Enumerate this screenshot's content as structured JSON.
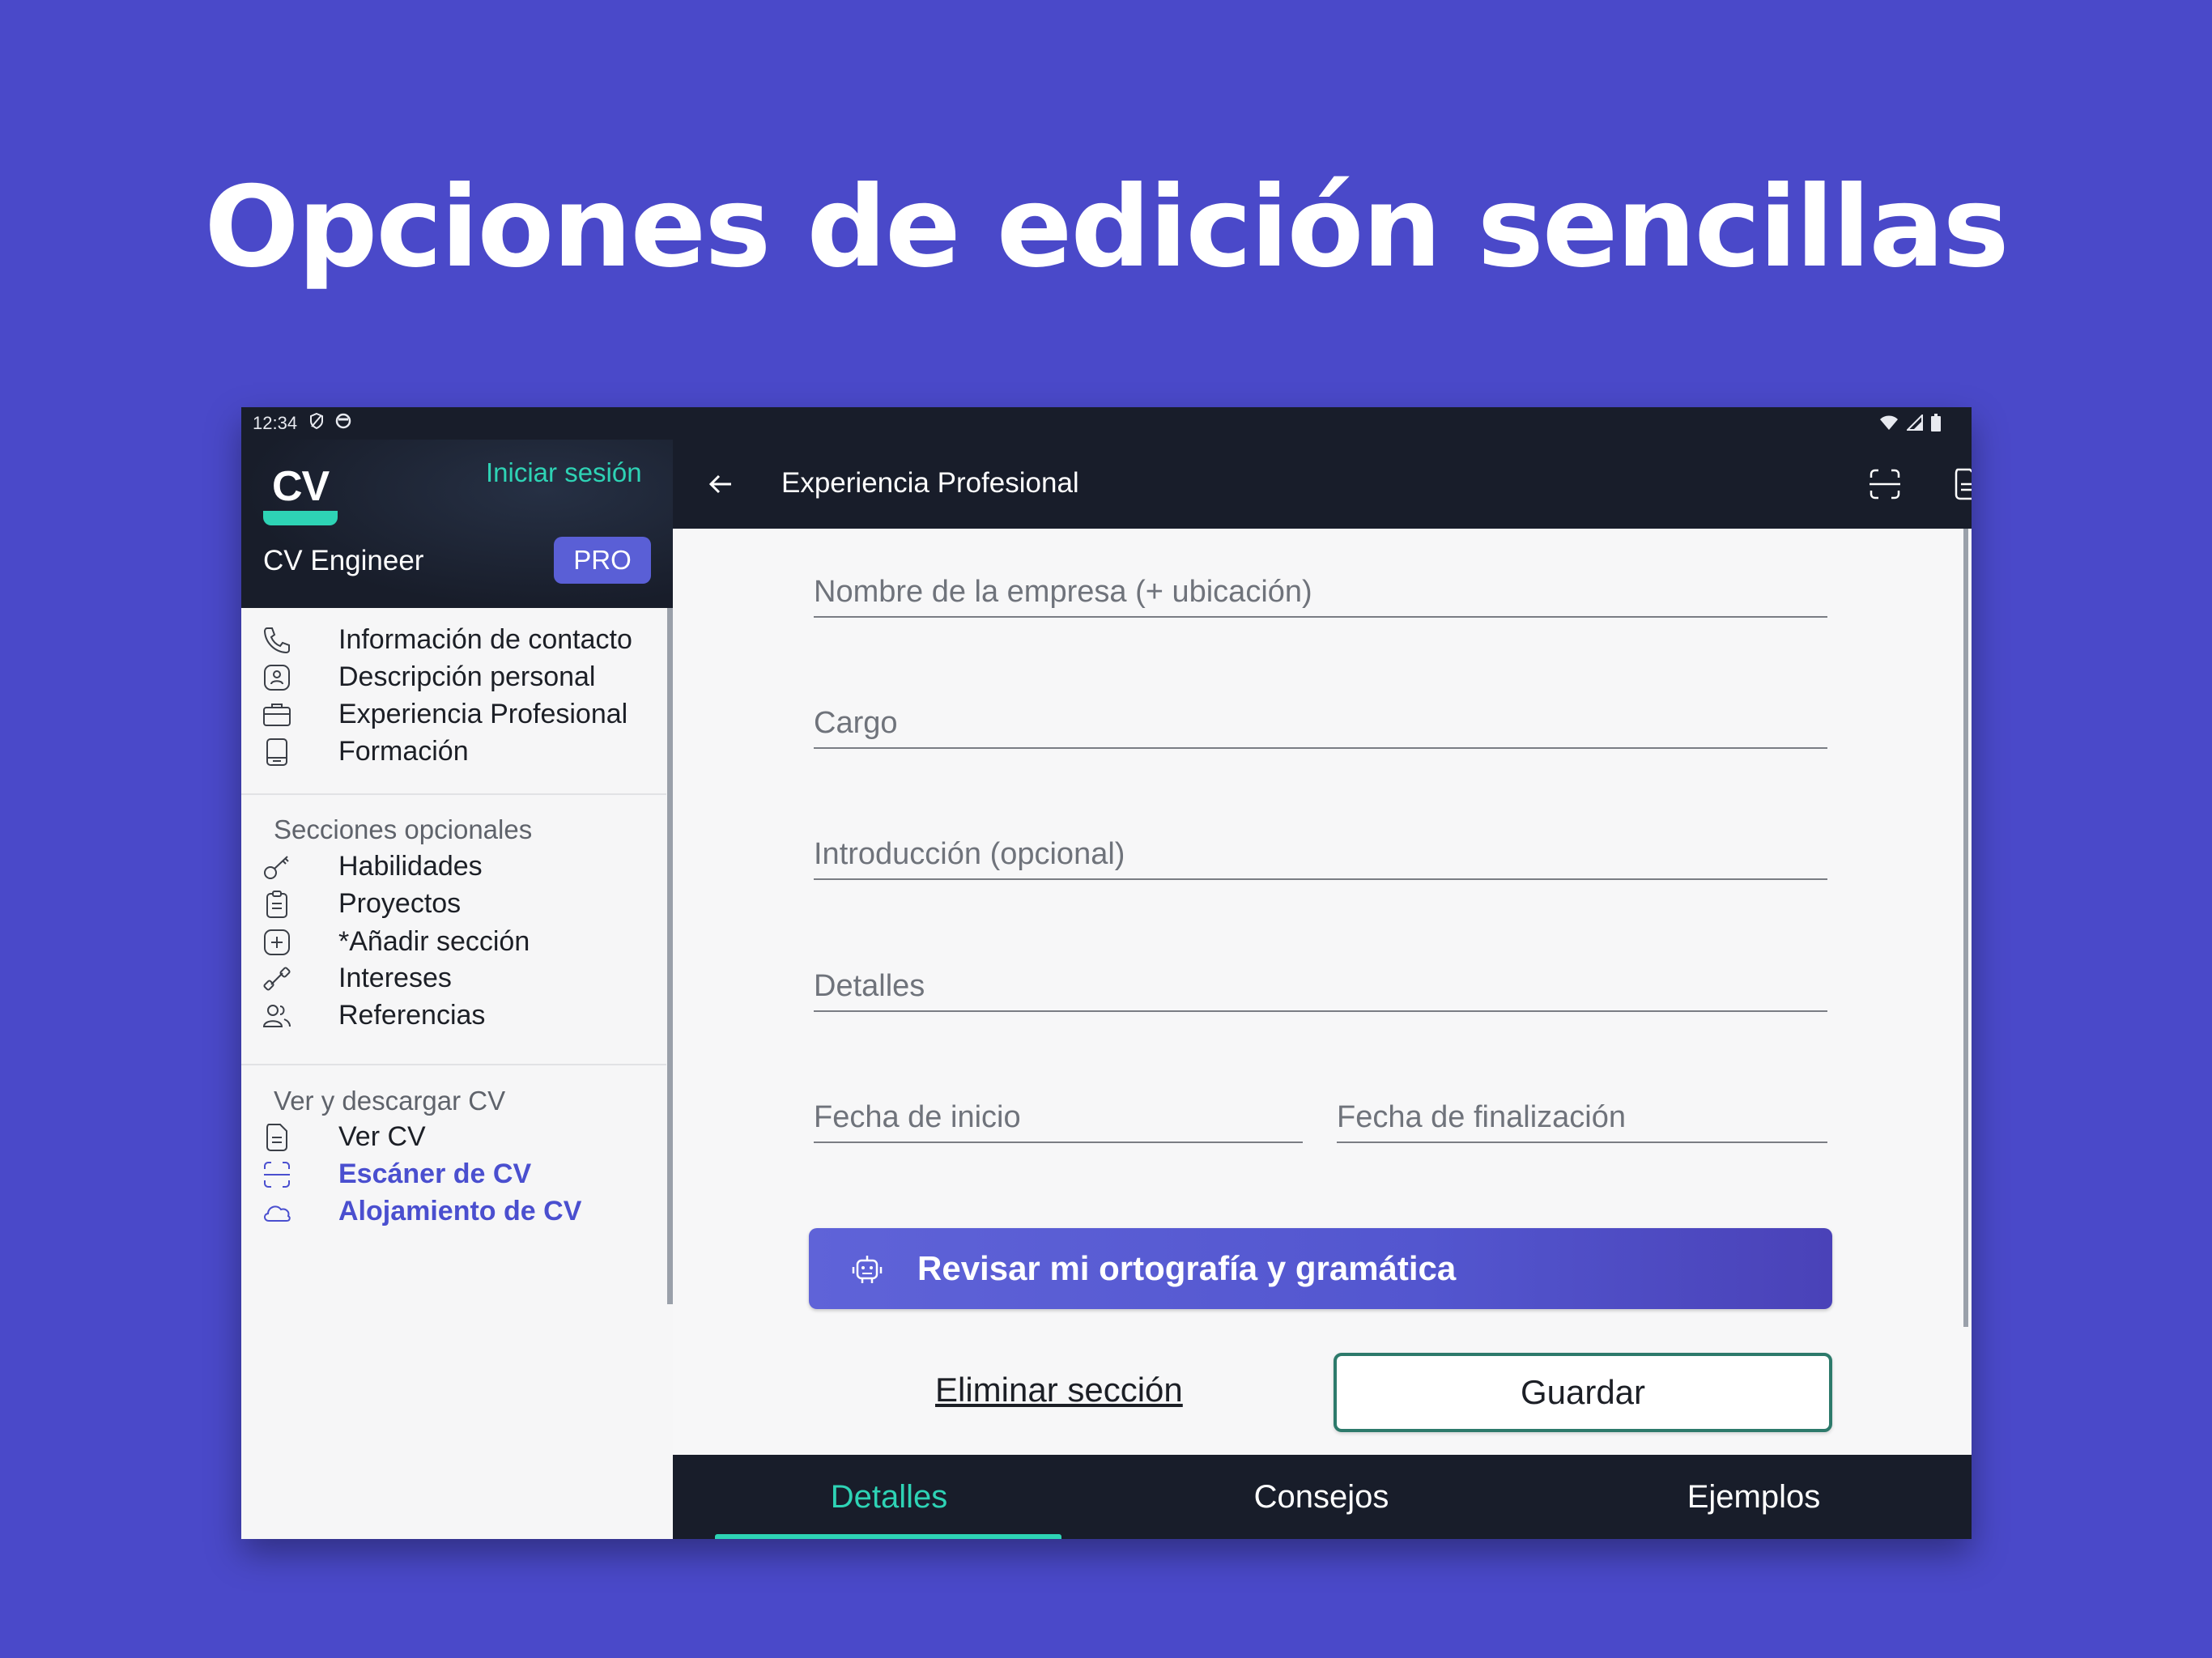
{
  "headline": "Opciones de edición sencillas",
  "status_bar": {
    "time": "12:34"
  },
  "sidebar": {
    "logo": "CV",
    "signin": "Iniciar sesión",
    "app_name": "CV Engineer",
    "pro_badge": "PRO",
    "main_items": [
      {
        "label": "Información de contacto",
        "icon": "phone-icon"
      },
      {
        "label": "Descripción personal",
        "icon": "person-badge-icon"
      },
      {
        "label": "Experiencia Profesional",
        "icon": "briefcase-icon"
      },
      {
        "label": "Formación",
        "icon": "book-icon"
      }
    ],
    "optional_title": "Secciones opcionales",
    "optional_items": [
      {
        "label": "Habilidades",
        "icon": "key-icon"
      },
      {
        "label": "Proyectos",
        "icon": "clipboard-icon"
      },
      {
        "label": "*Añadir sección",
        "icon": "plus-square-icon"
      },
      {
        "label": "Intereses",
        "icon": "dumbbell-icon"
      },
      {
        "label": "Referencias",
        "icon": "people-icon"
      }
    ],
    "download_title": "Ver y descargar CV",
    "download_items": [
      {
        "label": "Ver CV",
        "icon": "document-icon"
      },
      {
        "label": "Escáner de CV",
        "icon": "scan-icon"
      },
      {
        "label": "Alojamiento de CV",
        "icon": "cloud-icon"
      }
    ],
    "accent_color": "#4a4fcf"
  },
  "topbar": {
    "title": "Experiencia Profesional"
  },
  "form": {
    "company_placeholder": "Nombre de la empresa (+ ubicación)",
    "position_placeholder": "Cargo",
    "intro_placeholder": "Introducción (opcional)",
    "details_placeholder": "Detalles",
    "start_placeholder": "Fecha de inicio",
    "end_placeholder": "Fecha de finalización",
    "spellcheck_label": "Revisar mi ortografía y gramática",
    "delete_label": "Eliminar sección",
    "save_label": "Guardar"
  },
  "tabs": [
    {
      "label": "Detalles",
      "active": true
    },
    {
      "label": "Consejos",
      "active": false
    },
    {
      "label": "Ejemplos",
      "active": false
    }
  ],
  "colors": {
    "background": "#4a49c9",
    "teal": "#2ed3b5",
    "dark": "#181d2a"
  }
}
